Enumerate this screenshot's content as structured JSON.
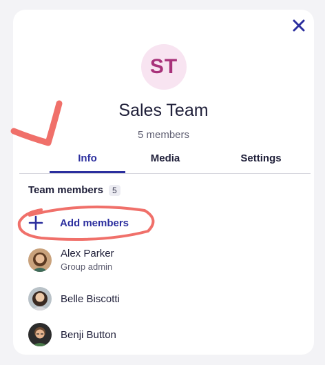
{
  "dialog": {
    "avatar_initials": "ST",
    "title": "Sales Team",
    "subtitle": "5 members",
    "close_icon": "close-icon"
  },
  "tabs": [
    {
      "label": "Info",
      "active": true
    },
    {
      "label": "Media",
      "active": false
    },
    {
      "label": "Settings",
      "active": false
    }
  ],
  "members_section": {
    "title": "Team members",
    "count": "5",
    "add_label": "Add members",
    "add_icon": "plus-icon"
  },
  "members": [
    {
      "name": "Alex Parker",
      "role": "Group admin"
    },
    {
      "name": "Belle Biscotti",
      "role": ""
    },
    {
      "name": "Benji Button",
      "role": ""
    }
  ],
  "colors": {
    "accent": "#2b2e9e",
    "avatar_bg": "#f8e4f1",
    "avatar_text": "#a8327a",
    "annotation": "#f0706a"
  }
}
